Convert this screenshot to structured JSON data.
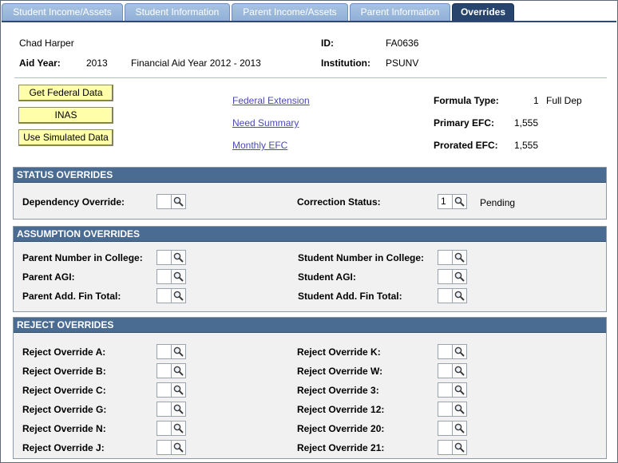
{
  "tabs": [
    {
      "label": "Student Income/Assets"
    },
    {
      "label": "Student Information"
    },
    {
      "label": "Parent Income/Assets"
    },
    {
      "label": "Parent Information"
    },
    {
      "label": "Overrides"
    }
  ],
  "header": {
    "student_name": "Chad Harper",
    "id_label": "ID:",
    "id_value": "FA0636",
    "aid_year_label": "Aid Year:",
    "aid_year_value": "2013",
    "aid_year_desc": "Financial Aid Year 2012 - 2013",
    "institution_label": "Institution:",
    "institution_value": "PSUNV"
  },
  "actions": {
    "get_federal_data": "Get Federal Data",
    "inas": "INAS",
    "use_simulated_data": "Use Simulated Data"
  },
  "links": {
    "federal_extension": "Federal Extension",
    "need_summary": "Need Summary",
    "monthly_efc": "Monthly EFC"
  },
  "summary": {
    "formula_type_label": "Formula Type:",
    "formula_type_code": "1",
    "formula_type_desc": "Full Dep",
    "primary_efc_label": "Primary EFC:",
    "primary_efc_value": "1,555",
    "prorated_efc_label": "Prorated EFC:",
    "prorated_efc_value": "1,555"
  },
  "status_overrides": {
    "title": "STATUS OVERRIDES",
    "dependency_override_label": "Dependency Override:",
    "dependency_override_value": "",
    "correction_status_label": "Correction Status:",
    "correction_status_value": "1",
    "correction_status_desc": "Pending"
  },
  "assumption_overrides": {
    "title": "ASSUMPTION OVERRIDES",
    "left": [
      {
        "label": "Parent Number in College:",
        "value": ""
      },
      {
        "label": "Parent AGI:",
        "value": ""
      },
      {
        "label": "Parent Add. Fin Total:",
        "value": ""
      }
    ],
    "right": [
      {
        "label": "Student Number in College:",
        "value": ""
      },
      {
        "label": "Student AGI:",
        "value": ""
      },
      {
        "label": "Student Add. Fin Total:",
        "value": ""
      }
    ]
  },
  "reject_overrides": {
    "title": "REJECT OVERRIDES",
    "left": [
      {
        "label": "Reject Override A:",
        "value": ""
      },
      {
        "label": "Reject Override B:",
        "value": ""
      },
      {
        "label": "Reject Override C:",
        "value": ""
      },
      {
        "label": "Reject Override G:",
        "value": ""
      },
      {
        "label": "Reject Override N:",
        "value": ""
      },
      {
        "label": "Reject Override J:",
        "value": ""
      }
    ],
    "right": [
      {
        "label": "Reject Override K:",
        "value": ""
      },
      {
        "label": "Reject Override W:",
        "value": ""
      },
      {
        "label": "Reject Override 3:",
        "value": ""
      },
      {
        "label": "Reject Override 12:",
        "value": ""
      },
      {
        "label": "Reject Override 20:",
        "value": ""
      },
      {
        "label": "Reject Override 21:",
        "value": ""
      }
    ]
  },
  "colors": {
    "tab_active": "#27446d",
    "tab_inactive": "#9bb8dc",
    "section_header": "#4a6b92",
    "button_fill": "#ffffaa",
    "link": "#4a4ab5"
  }
}
